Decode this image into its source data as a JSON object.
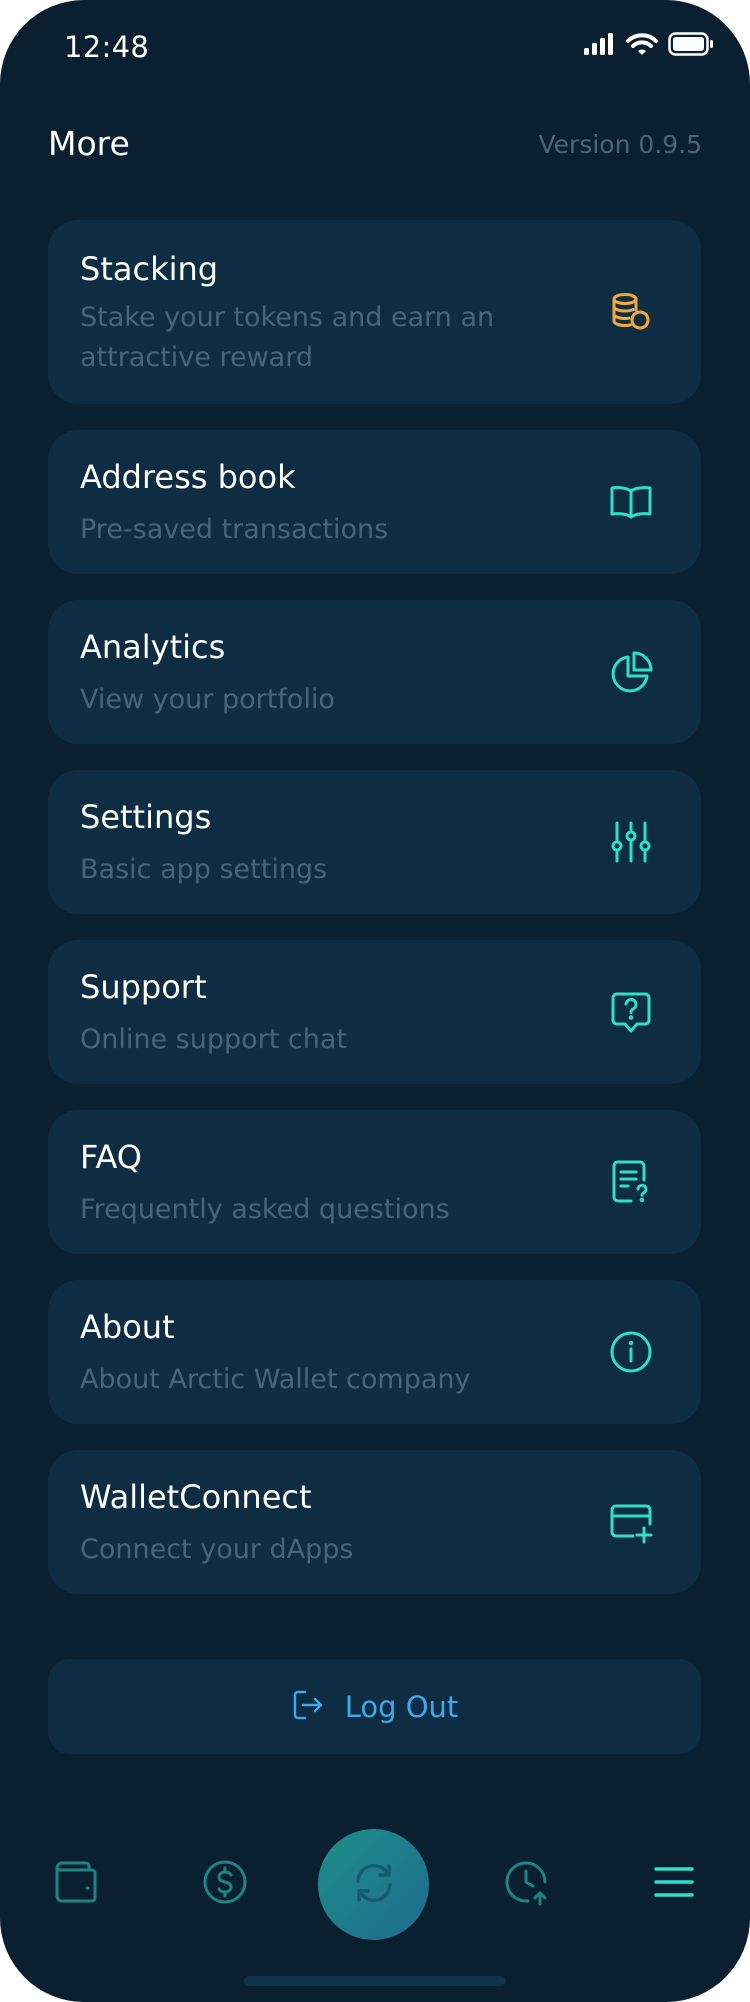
{
  "status_bar": {
    "time": "12:48",
    "signal_icon": "signal-icon",
    "wifi_icon": "wifi-icon",
    "battery_icon": "battery-icon"
  },
  "header": {
    "title": "More",
    "version": "Version 0.9.5"
  },
  "menu": {
    "items": [
      {
        "title": "Stacking",
        "subtitle": "Stake your tokens and earn an attractive reward",
        "icon": "coins-icon",
        "icon_color": "#f0a93a"
      },
      {
        "title": "Address book",
        "subtitle": "Pre-saved transactions",
        "icon": "book-icon",
        "icon_color": "#2fe0c8"
      },
      {
        "title": "Analytics",
        "subtitle": "View your portfolio",
        "icon": "pie-chart-icon",
        "icon_color": "#2fe0c8"
      },
      {
        "title": "Settings",
        "subtitle": "Basic app settings",
        "icon": "sliders-icon",
        "icon_color": "#2fe0c8"
      },
      {
        "title": "Support",
        "subtitle": "Online support chat",
        "icon": "help-chat-icon",
        "icon_color": "#2fe0c8"
      },
      {
        "title": "FAQ",
        "subtitle": "Frequently asked questions",
        "icon": "faq-document-icon",
        "icon_color": "#2fe0c8"
      },
      {
        "title": "About",
        "subtitle": "About Arctic Wallet company",
        "icon": "info-icon",
        "icon_color": "#2fe0c8"
      },
      {
        "title": "WalletConnect",
        "subtitle": "Connect your dApps",
        "icon": "card-add-icon",
        "icon_color": "#2fe0c8"
      }
    ]
  },
  "logout": {
    "label": "Log Out",
    "icon": "logout-icon"
  },
  "bottom_nav": {
    "items": [
      {
        "name": "wallet",
        "icon": "wallet-icon"
      },
      {
        "name": "dollar",
        "icon": "dollar-icon"
      },
      {
        "name": "swap",
        "icon": "swap-icon"
      },
      {
        "name": "history",
        "icon": "history-icon"
      },
      {
        "name": "menu",
        "icon": "menu-icon"
      }
    ]
  },
  "colors": {
    "background": "#0a1f30",
    "card": "#0e2d43",
    "accent": "#2fe0c8",
    "orange": "#f0a93a",
    "link": "#3fa8ea",
    "muted_text": "#46657a"
  }
}
